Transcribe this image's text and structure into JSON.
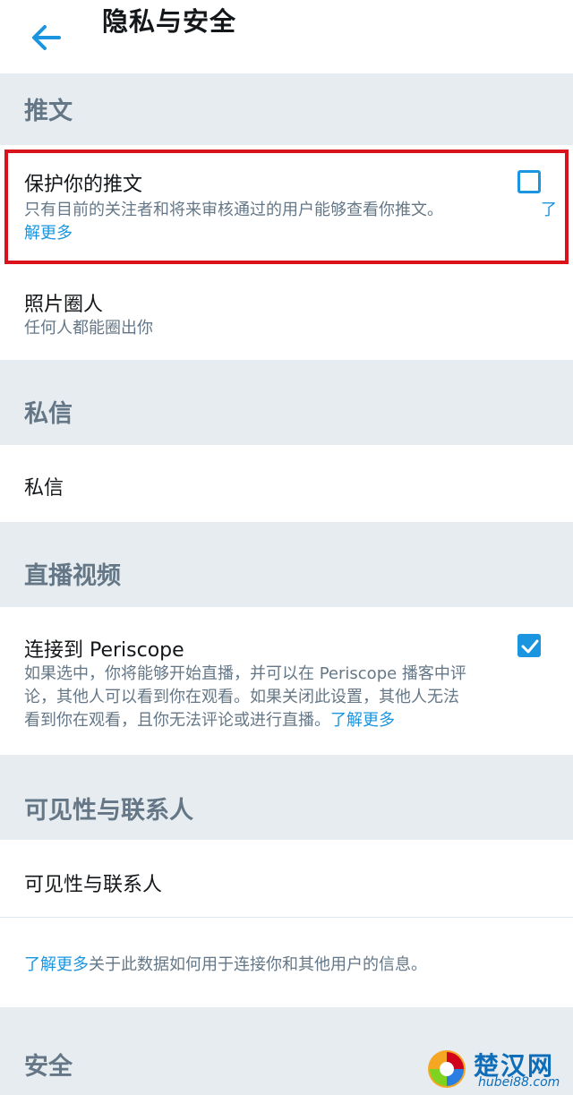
{
  "header": {
    "title": "隐私与安全",
    "back_icon": "arrow-left-icon"
  },
  "sections": {
    "tweets": {
      "header": "推文",
      "protect": {
        "title": "保护你的推文",
        "desc": "只有目前的关注者和将来审核通过的用户能够查看你推文。",
        "link_part1": "了",
        "link_part2": "解更多",
        "checked": false
      },
      "photo_tag": {
        "title": "照片圈人",
        "sub": "任何人都能圈出你"
      }
    },
    "dm": {
      "header": "私信",
      "item": "私信"
    },
    "live": {
      "header": "直播视频",
      "periscope": {
        "title": "连接到 Periscope",
        "desc_line1": "如果选中，你将能够开始直播，并可以在 Periscope 播客中评",
        "desc_line2": "论，其他人可以看到你在观看。如果关闭此设置，其他人无法",
        "desc_line3": "看到你在观看，且你无法评论或进行直播。",
        "link": "了解更多",
        "checked": true
      }
    },
    "visibility": {
      "header": "可见性与联系人",
      "item": "可见性与联系人",
      "info_link": "了解更多",
      "info_text": "关于此数据如何用于连接你和其他用户的信息。"
    },
    "security": {
      "header": "安全"
    }
  },
  "watermark": {
    "brand": "楚汉网",
    "domain": "hubei88.com"
  },
  "colors": {
    "accent": "#1b95e0",
    "section_bg": "#e6ecf0",
    "highlight": "#d9121b"
  }
}
